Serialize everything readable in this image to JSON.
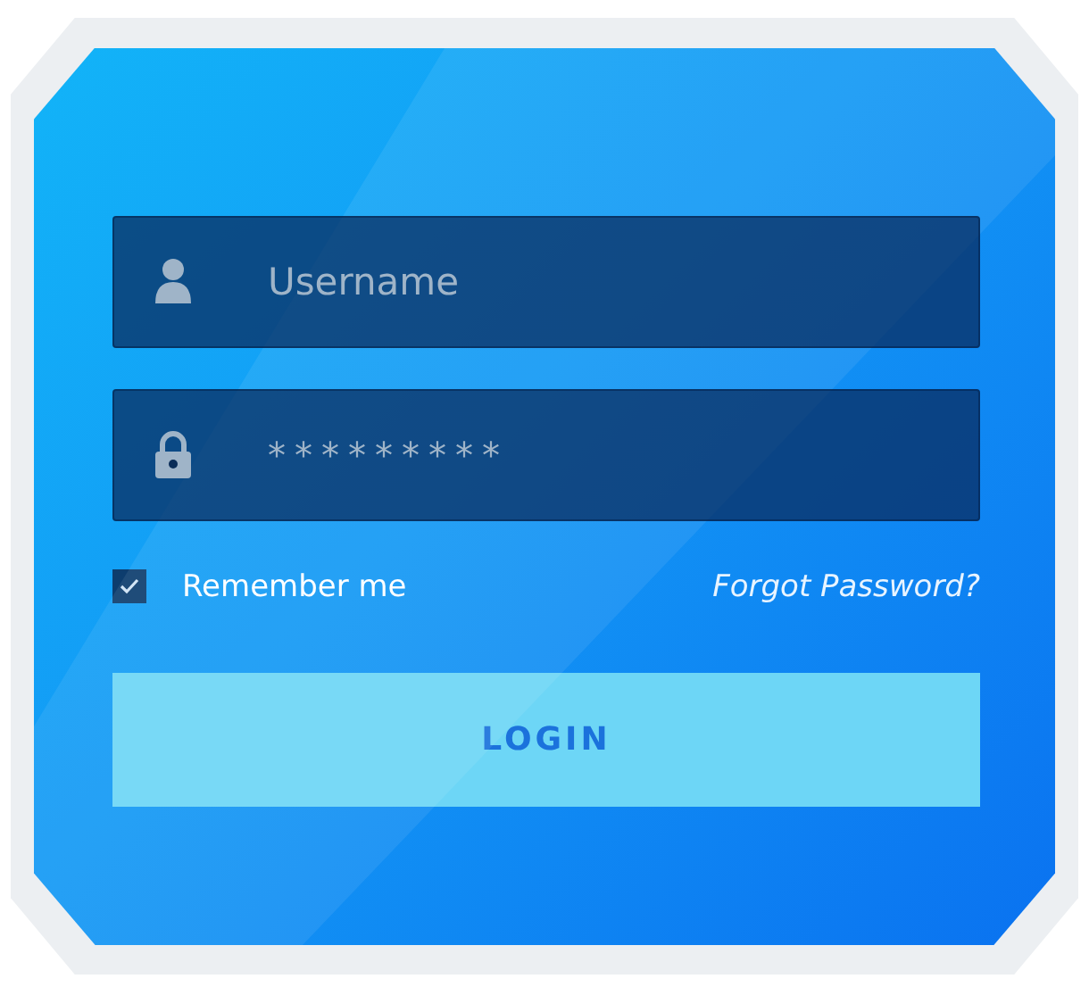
{
  "username": {
    "placeholder": "Username"
  },
  "password": {
    "value": "*********"
  },
  "remember": {
    "label": "Remember me",
    "checked": true
  },
  "forgot_link": "Forgot Password?",
  "login_button": "LOGIN"
}
